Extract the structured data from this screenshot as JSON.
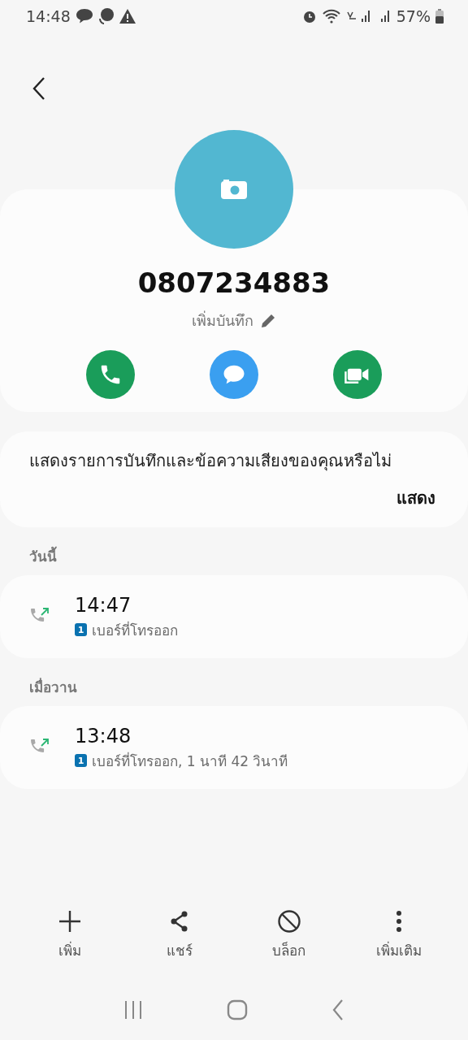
{
  "status_bar": {
    "time": "14:48",
    "battery": "57%"
  },
  "contact": {
    "number": "0807234883",
    "add_note": "เพิ่มบันทึก"
  },
  "actions": [
    {
      "kind": "call"
    },
    {
      "kind": "message"
    },
    {
      "kind": "video"
    }
  ],
  "notice": {
    "text": "แสดงรายการบันทึกและข้อความเสียงของคุณหรือไม่",
    "action": "แสดง"
  },
  "call_log": [
    {
      "heading": "วันนี้",
      "calls": [
        {
          "time": "14:47",
          "sim": "1",
          "detail": "เบอร์ที่โทรออก"
        }
      ]
    },
    {
      "heading": "เมื่อวาน",
      "calls": [
        {
          "time": "13:48",
          "sim": "1",
          "detail": "เบอร์ที่โทรออก, 1 นาที 42 วินาที"
        }
      ]
    }
  ],
  "bottom_actions": [
    {
      "kind": "add",
      "label": "เพิ่ม"
    },
    {
      "kind": "share",
      "label": "แชร์"
    },
    {
      "kind": "block",
      "label": "บล็อก"
    },
    {
      "kind": "more",
      "label": "เพิ่มเติม"
    }
  ]
}
